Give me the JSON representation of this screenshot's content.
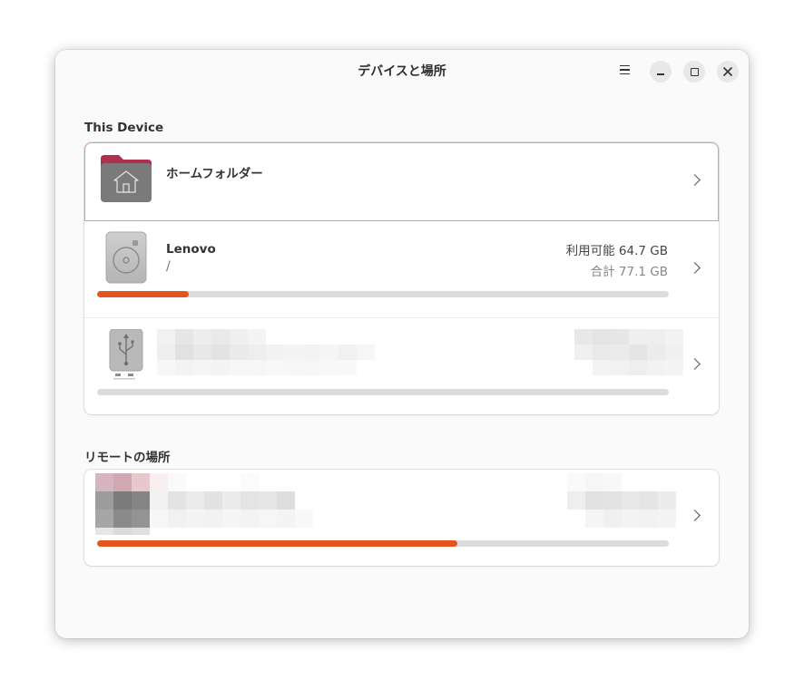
{
  "window": {
    "title": "デバイスと場所"
  },
  "titlebar_controls": {
    "menu_icon": "hamburger-menu-icon",
    "minimize_icon": "minimize-icon",
    "maximize_icon": "maximize-icon",
    "close_icon": "close-icon"
  },
  "sections": {
    "this_device": "This Device",
    "remote": "リモートの場所"
  },
  "devices": [
    {
      "name": "ホームフォルダー",
      "icon": "home-folder-icon",
      "selected": true
    },
    {
      "name": "Lenovo",
      "path": "/",
      "free": "利用可能 64.7 GB",
      "total": "合計 77.1 GB",
      "used_fraction": 0.16,
      "icon": "hard-disk-icon"
    },
    {
      "name": "",
      "icon": "usb-drive-icon",
      "used_fraction": 0.0,
      "obscured": true
    }
  ],
  "remote_locations": [
    {
      "name": "",
      "icon": "network-location-icon",
      "used_fraction": 0.63,
      "obscured": true
    }
  ],
  "colors": {
    "accent": "#e3541f",
    "selection_border": "#e79c80",
    "folder_tab": "#b0304f",
    "folder_body": "#7a7a7a"
  }
}
